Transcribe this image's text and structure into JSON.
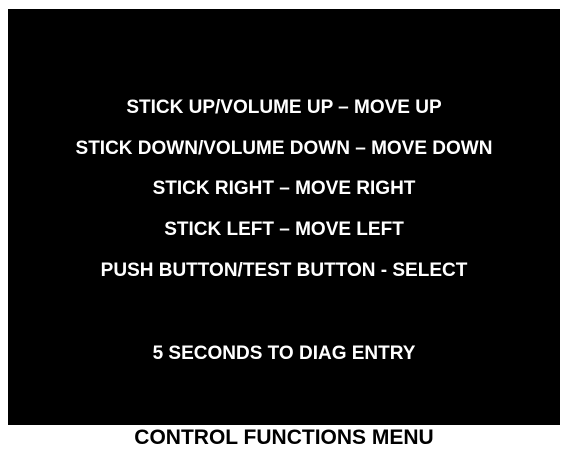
{
  "screen": {
    "lines": [
      "STICK UP/VOLUME UP – MOVE UP",
      "STICK DOWN/VOLUME DOWN – MOVE DOWN",
      "STICK RIGHT – MOVE RIGHT",
      "STICK LEFT – MOVE LEFT",
      "PUSH BUTTON/TEST BUTTON - SELECT"
    ],
    "countdown": "5 SECONDS TO DIAG ENTRY"
  },
  "caption": "CONTROL FUNCTIONS MENU",
  "colors": {
    "screen_background": "#000000",
    "screen_text": "#ffffff",
    "page_background": "#ffffff",
    "caption_text": "#000000"
  }
}
